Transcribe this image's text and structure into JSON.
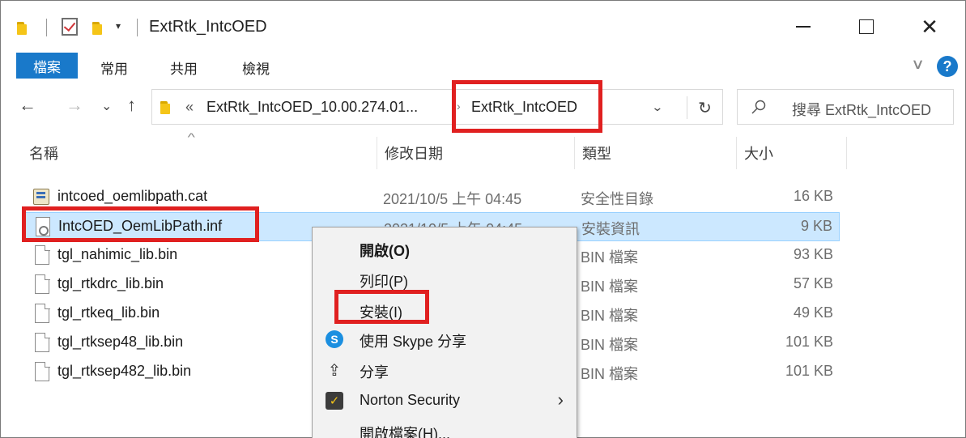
{
  "window": {
    "title": "ExtRtk_IntcOED",
    "quick_access_arrow": "▾",
    "minimize_glyph": "—",
    "maximize_glyph": "☐",
    "close_glyph": "✕"
  },
  "ribbon": {
    "tabs": [
      "檔案",
      "常用",
      "共用",
      "檢視"
    ],
    "collapse_glyph": "∨",
    "help_glyph": "?"
  },
  "nav": {
    "back": "←",
    "forward": "→",
    "recent": "⌄",
    "up": "↑"
  },
  "address": {
    "overflow": "«",
    "segments": [
      "ExtRtk_IntcOED_10.00.274.01...",
      "ExtRtk_IntcOED"
    ],
    "separator": "›",
    "dropdown_glyph": "⌄",
    "refresh_glyph": "↻"
  },
  "search": {
    "placeholder": "搜尋 ExtRtk_IntcOED"
  },
  "columns": {
    "name": "名稱",
    "date": "修改日期",
    "type": "類型",
    "size": "大小",
    "sort_glyph": "^"
  },
  "files": [
    {
      "name": "intcoed_oemlibpath.cat",
      "date": "2021/10/5 上午 04:45",
      "type": "安全性目錄",
      "size": "16 KB",
      "icon": "catalog-file-icon"
    },
    {
      "name": "IntcOED_OemLibPath.inf",
      "date": "2021/10/5 上午 04:45",
      "type": "安裝資訊",
      "size": "9 KB",
      "icon": "setup-information-file-icon",
      "selected": true
    },
    {
      "name": "tgl_nahimic_lib.bin",
      "date": "",
      "type": "BIN 檔案",
      "size": "93 KB",
      "icon": "blank-file-icon"
    },
    {
      "name": "tgl_rtkdrc_lib.bin",
      "date": "",
      "type": "BIN 檔案",
      "size": "57 KB",
      "icon": "blank-file-icon"
    },
    {
      "name": "tgl_rtkeq_lib.bin",
      "date": "",
      "type": "BIN 檔案",
      "size": "49 KB",
      "icon": "blank-file-icon"
    },
    {
      "name": "tgl_rtksep48_lib.bin",
      "date": "",
      "type": "BIN 檔案",
      "size": "101 KB",
      "icon": "blank-file-icon"
    },
    {
      "name": "tgl_rtksep482_lib.bin",
      "date": "",
      "type": "BIN 檔案",
      "size": "101 KB",
      "icon": "blank-file-icon"
    }
  ],
  "context_menu": {
    "items": [
      {
        "label": "開啟(O)",
        "bold": true
      },
      {
        "label": "列印(P)"
      },
      {
        "label": "安裝(I)",
        "highlighted": true
      },
      {
        "label": "使用 Skype 分享",
        "icon": "skype-icon",
        "icon_glyph": "S"
      },
      {
        "label": "分享",
        "icon": "share-icon",
        "icon_glyph": "⇪"
      },
      {
        "label": "Norton Security",
        "icon": "norton-icon",
        "icon_glyph": "✓",
        "submenu_glyph": "›"
      },
      {
        "label": "開啟檔案(H)..."
      }
    ]
  },
  "colors": {
    "highlight_box": "#e02020",
    "file_tab": "#1979ca",
    "selection": "#cce8ff"
  }
}
